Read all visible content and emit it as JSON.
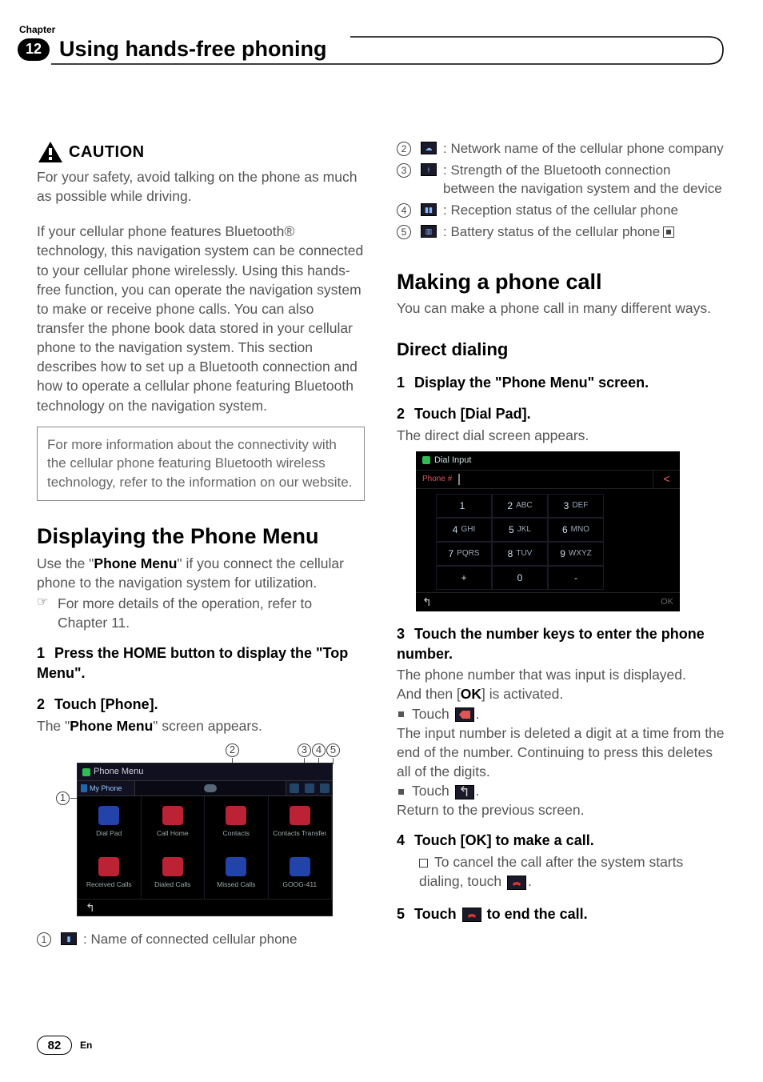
{
  "header": {
    "chapter_label": "Chapter",
    "chapter_num": "12",
    "title": "Using hands-free phoning"
  },
  "left": {
    "caution_label": "CAUTION",
    "caution_body": "For your safety, avoid talking on the phone as much as possible while driving.",
    "intro": "If your cellular phone features Bluetooth® technology, this navigation system can be connected to your cellular phone wirelessly. Using this hands-free function, you can operate the navigation system to make or receive phone calls. You can also transfer the phone book data stored in your cellular phone to the navigation system. This section describes how to set up a Bluetooth connection and how to operate a cellular phone featuring Bluetooth technology on the navigation system.",
    "info_box": "For more information about the connectivity with the cellular phone featuring Bluetooth wireless technology, refer to the information on our website.",
    "h2_prefix": "Displaying the ",
    "h2_suffix": "Phone Menu",
    "use_text_1": "Use the \"",
    "use_text_bold": "Phone Menu",
    "use_text_2": "\" if you connect the cellular phone to the navigation system for utilization.",
    "pointer": "For more details of the operation, refer to Chapter 11.",
    "step1": "Press the HOME button to display the \"Top Menu\".",
    "step2": "Touch [Phone].",
    "step2_after_1": "The \"",
    "step2_after_bold": "Phone Menu",
    "step2_after_2": "\" screen appears.",
    "legend1_icon_name": "device-icon",
    "legend1": "Name of connected cellular phone"
  },
  "phone_menu_fig": {
    "title": "Phone Menu",
    "connected": "My Phone",
    "cells": [
      "Dial Pad",
      "Call Home",
      "Contacts",
      "Contacts Transfer",
      "Received Calls",
      "Dialed Calls",
      "Missed Calls",
      "GOOG-411"
    ],
    "callout_2": "2",
    "callout_3": "3",
    "callout_4": "4",
    "callout_5": "5",
    "callout_1": "1"
  },
  "right": {
    "legend2": "Network name of the cellular phone company",
    "legend3": "Strength of the Bluetooth connection between the navigation system and the device",
    "legend4": "Reception status of the cellular phone",
    "legend5": "Battery status of the cellular phone",
    "h2_call": "Making a phone call",
    "call_intro": "You can make a phone call in many different ways.",
    "h3_direct": "Direct dialing",
    "dd_step1": "Display the \"Phone Menu\" screen.",
    "dd_step2": "Touch [Dial Pad].",
    "dd_step2_after": "The direct dial screen appears.",
    "dd_step3": "Touch the number keys to enter the phone number.",
    "dd_s3_line1": "The phone number that was input is displayed.",
    "dd_s3_line2a": "And then [",
    "dd_s3_line2b": "OK",
    "dd_s3_line2c": "] is activated.",
    "dd_s3_touch1": "Touch ",
    "dd_s3_touch1_after": ".",
    "dd_s3_exp1": "The input number is deleted a digit at a time from the end of the number. Continuing to press this deletes all of the digits.",
    "dd_s3_touch2": "Touch ",
    "dd_s3_touch2_after": ".",
    "dd_s3_exp2": "Return to the previous screen.",
    "dd_step4": "Touch [OK] to make a call.",
    "dd_s4_sub_a": "To cancel the call after the system starts dialing, touch ",
    "dd_s4_sub_b": ".",
    "dd_step5_a": "Touch ",
    "dd_step5_b": " to end the call."
  },
  "dial_fig": {
    "title": "Dial Input",
    "input_label": "Phone #",
    "keys": [
      {
        "n": "1",
        "t": ""
      },
      {
        "n": "2",
        "t": "ABC"
      },
      {
        "n": "3",
        "t": "DEF"
      },
      {
        "n": "4",
        "t": "GHI"
      },
      {
        "n": "5",
        "t": "JKL"
      },
      {
        "n": "6",
        "t": "MNO"
      },
      {
        "n": "7",
        "t": "PQRS"
      },
      {
        "n": "8",
        "t": "TUV"
      },
      {
        "n": "9",
        "t": "WXYZ"
      },
      {
        "n": "+",
        "t": ""
      },
      {
        "n": "0",
        "t": ""
      },
      {
        "n": "-",
        "t": ""
      }
    ],
    "ok": "OK"
  },
  "footer": {
    "page": "82",
    "lang": "En"
  }
}
